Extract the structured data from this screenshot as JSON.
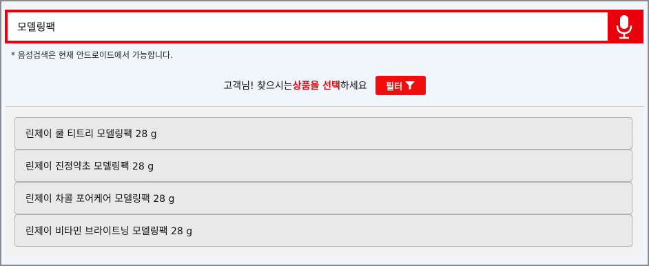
{
  "search": {
    "value": "모델링팩",
    "placeholder": ""
  },
  "icons": {
    "mic": "microphone-icon",
    "filter": "funnel-icon"
  },
  "colors": {
    "accent": "#e8000a",
    "page_bg": "#f0f6fc",
    "item_bg": "#e9e9e9"
  },
  "note": "* 음성검색은 현재 안드로이드에서 가능합니다.",
  "prompt": {
    "prefix": "고객님! 찾으시는 ",
    "highlight": "상품을 선택",
    "suffix": "하세요"
  },
  "filter_label": "필터",
  "results": [
    "린제이 쿨 티트리 모델링팩 28 g",
    "린제이 진정약초 모델링팩 28 g",
    "린제이 차콜 포어케어 모델링팩 28 g",
    "린제이 비타민 브라이트닝 모델링팩 28 g"
  ]
}
